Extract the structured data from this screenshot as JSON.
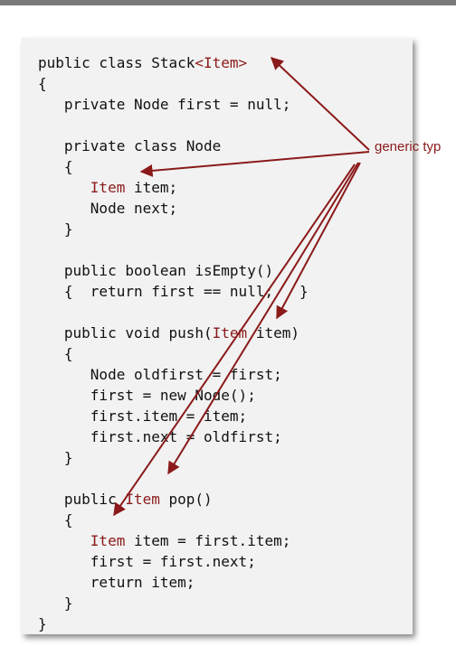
{
  "label": "generic typ",
  "colors": {
    "generic": "#8b1a1a",
    "code": "#111111",
    "card": "#f2f2f2"
  },
  "code_lines": [
    [
      "public class Stack",
      "<Item>",
      ""
    ],
    [
      "{",
      "",
      ""
    ],
    [
      "   private Node first = null;",
      "",
      ""
    ],
    [
      "",
      "",
      ""
    ],
    [
      "   private class Node",
      "",
      ""
    ],
    [
      "   {",
      "",
      ""
    ],
    [
      "      ",
      "Item",
      " item;"
    ],
    [
      "      Node next;",
      "",
      ""
    ],
    [
      "   }",
      "",
      ""
    ],
    [
      "",
      "",
      ""
    ],
    [
      "   public boolean isEmpty()",
      "",
      ""
    ],
    [
      "   {  return first == null;   }",
      "",
      ""
    ],
    [
      "",
      "",
      ""
    ],
    [
      "   public void push(",
      "Item",
      " item)"
    ],
    [
      "   {",
      "",
      ""
    ],
    [
      "      Node oldfirst = first;",
      "",
      ""
    ],
    [
      "      first = new Node();",
      "",
      ""
    ],
    [
      "      first.item = item;",
      "",
      ""
    ],
    [
      "      first.next = oldfirst;",
      "",
      ""
    ],
    [
      "   }",
      "",
      ""
    ],
    [
      "",
      "",
      ""
    ],
    [
      "   public ",
      "Item",
      " pop()"
    ],
    [
      "   {",
      "",
      ""
    ],
    [
      "      ",
      "Item",
      " item = first.item;"
    ],
    [
      "      first = first.next;",
      "",
      ""
    ],
    [
      "      return item;",
      "",
      ""
    ],
    [
      "   }",
      "",
      ""
    ],
    [
      "}",
      "",
      ""
    ]
  ]
}
